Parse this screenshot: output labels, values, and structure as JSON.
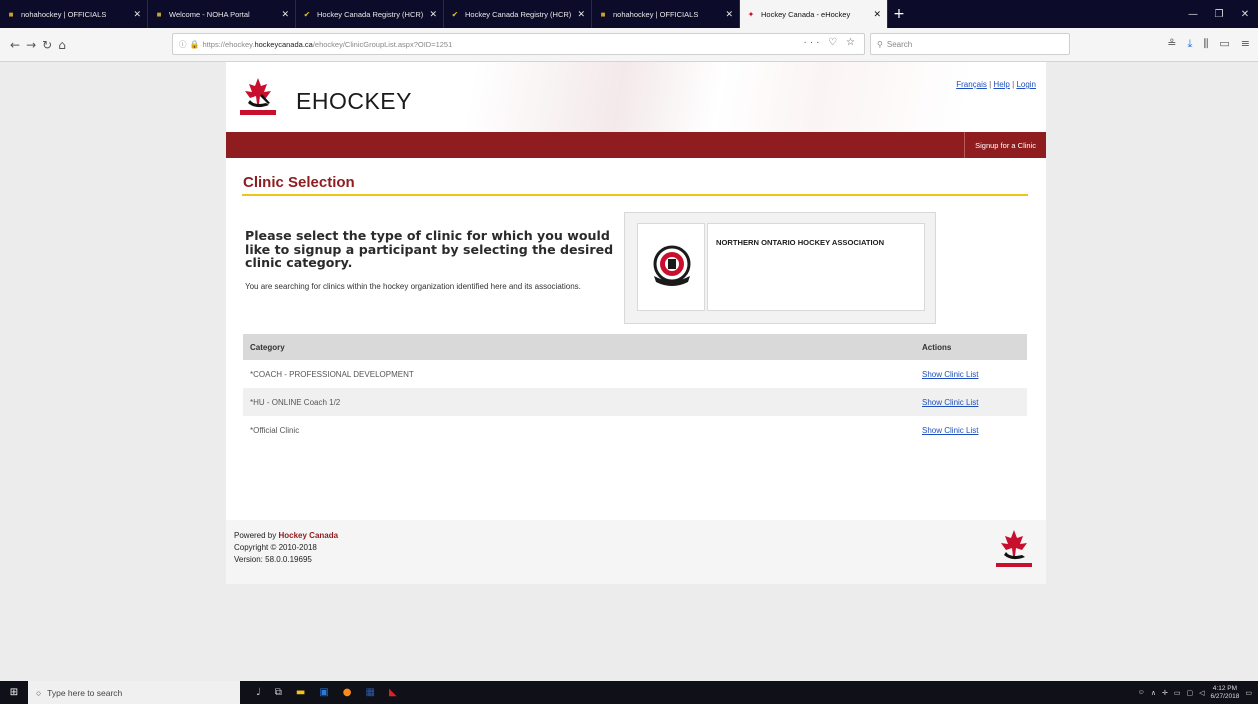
{
  "browser": {
    "tabs": [
      {
        "title": "nohahockey | OFFICIALS",
        "icon": "hockey-favicon"
      },
      {
        "title": "Welcome - NOHA Portal",
        "icon": "hockey-favicon"
      },
      {
        "title": "Hockey Canada Registry (HCR)",
        "icon": "hcr-favicon"
      },
      {
        "title": "Hockey Canada Registry (HCR)",
        "icon": "hcr-favicon"
      },
      {
        "title": "nohahockey | OFFICIALS",
        "icon": "hockey-favicon"
      },
      {
        "title": "Hockey Canada - eHockey",
        "icon": "maple-leaf-favicon"
      }
    ],
    "new_tab": "+",
    "url_prefix": "https://ehockey.",
    "url_host": "hockeycanada.ca",
    "url_path": "/ehockey/ClinicGroupList.aspx?OID=1251",
    "url_actions": "··· ♡ ☆",
    "search_placeholder": "Search"
  },
  "header": {
    "brand": "EHOCKEY",
    "link_francais": "Français",
    "link_help": "Help",
    "link_login": "Login",
    "signup": "Signup for a Clinic"
  },
  "main": {
    "title": "Clinic Selection",
    "instruction": "Please select the type of clinic for which you would like to signup a participant by selecting the desired clinic category.",
    "subinstruction": "You are searching for clinics within the hockey organization identified here and its associations.",
    "organization": "NORTHERN ONTARIO HOCKEY ASSOCIATION"
  },
  "table": {
    "headers": [
      "Category",
      "Actions"
    ],
    "rows": [
      {
        "category": "*COACH - PROFESSIONAL DEVELOPMENT",
        "action": "Show Clinic List"
      },
      {
        "category": "*HU - ONLINE Coach 1/2",
        "action": "Show Clinic List"
      },
      {
        "category": "*Official Clinic",
        "action": "Show Clinic List"
      }
    ]
  },
  "footer": {
    "powered_by": "Powered by",
    "powered_name": "Hockey Canada",
    "copyright": "Copyright © 2010-2018",
    "version": "Version: 58.0.0.19695"
  },
  "taskbar": {
    "search_placeholder": "Type here to search",
    "time": "4:12 PM",
    "date": "6/27/2018"
  },
  "colors": {
    "brand_red": "#8f1c1f",
    "accent_yellow": "#f0c419",
    "link_blue": "#1f4fbf"
  }
}
